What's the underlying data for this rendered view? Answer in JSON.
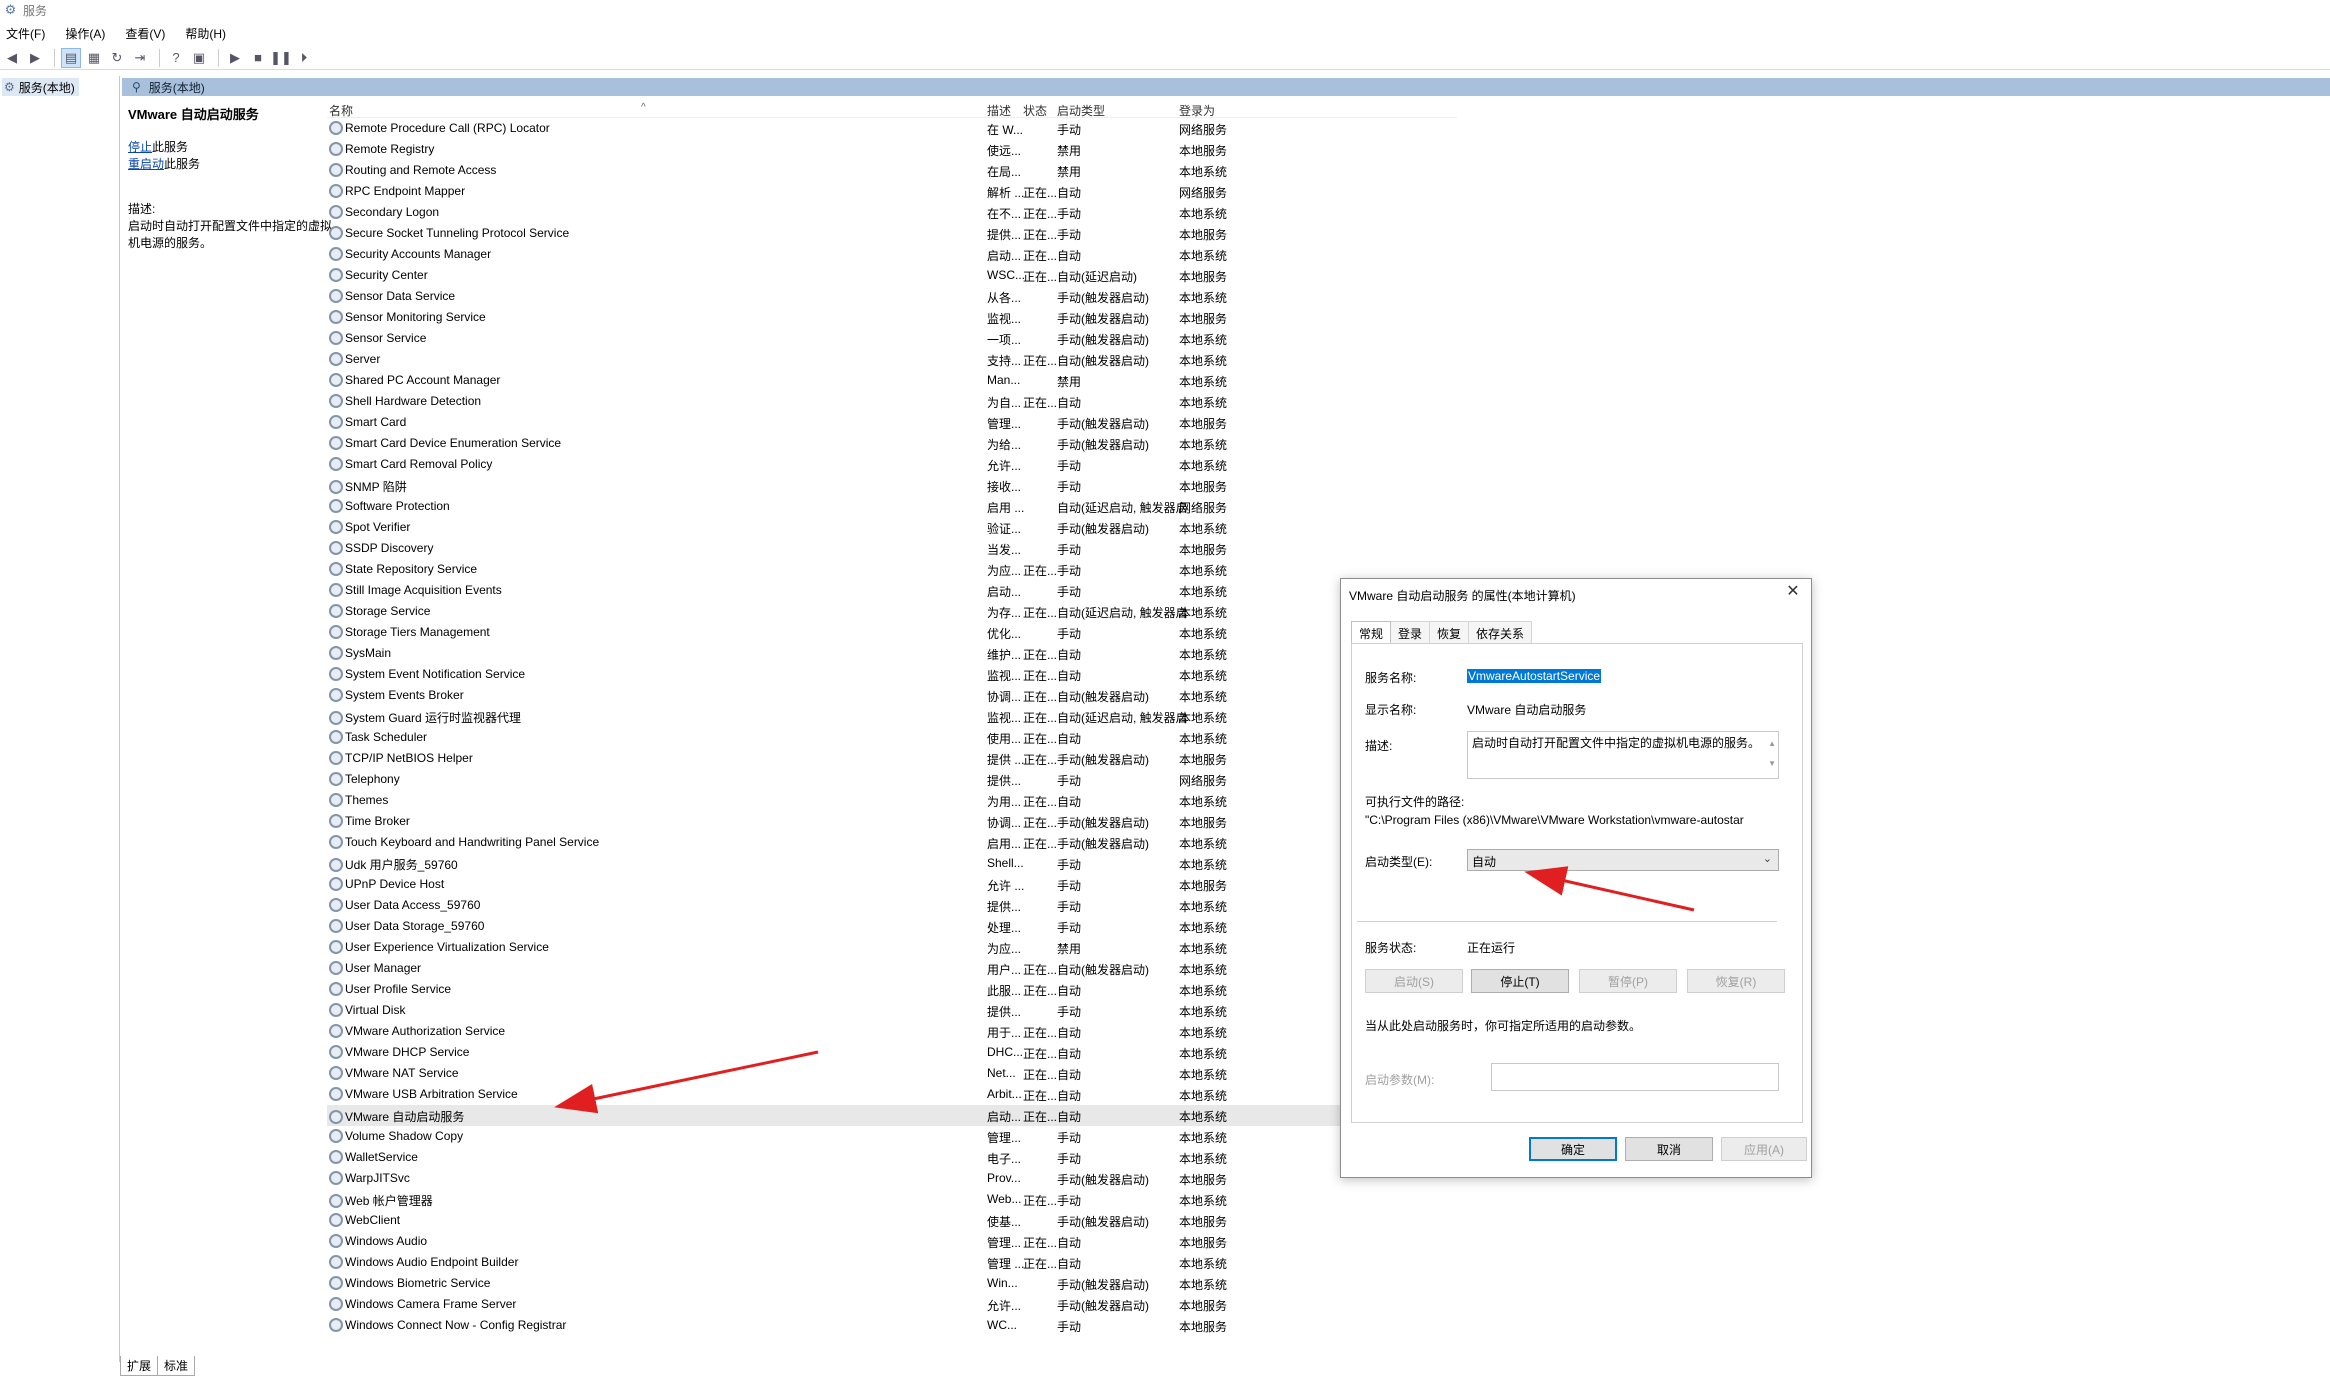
{
  "window": {
    "title": "服务"
  },
  "menu": [
    "文件(F)",
    "操作(A)",
    "查看(V)",
    "帮助(H)"
  ],
  "tree": {
    "root": "服务(本地)"
  },
  "pane": {
    "header": "服务(本地)"
  },
  "desc": {
    "service_name": "VMware 自动启动服务",
    "stop_link": "停止",
    "stop_suffix": "此服务",
    "restart_link": "重启动",
    "restart_suffix": "此服务",
    "label": "描述:",
    "text": "启动时自动打开配置文件中指定的虚拟机电源的服务。"
  },
  "columns": {
    "name": "名称",
    "desc": "描述",
    "status": "状态",
    "startup": "启动类型",
    "logon": "登录为"
  },
  "rows": [
    {
      "name": "Remote Procedure Call (RPC) Locator",
      "desc": "在 W...",
      "status": "",
      "startup": "手动",
      "logon": "网络服务"
    },
    {
      "name": "Remote Registry",
      "desc": "使远...",
      "status": "",
      "startup": "禁用",
      "logon": "本地服务"
    },
    {
      "name": "Routing and Remote Access",
      "desc": "在局...",
      "status": "",
      "startup": "禁用",
      "logon": "本地系统"
    },
    {
      "name": "RPC Endpoint Mapper",
      "desc": "解析 ...",
      "status": "正在...",
      "startup": "自动",
      "logon": "网络服务"
    },
    {
      "name": "Secondary Logon",
      "desc": "在不...",
      "status": "正在...",
      "startup": "手动",
      "logon": "本地系统"
    },
    {
      "name": "Secure Socket Tunneling Protocol Service",
      "desc": "提供...",
      "status": "正在...",
      "startup": "手动",
      "logon": "本地服务"
    },
    {
      "name": "Security Accounts Manager",
      "desc": "启动...",
      "status": "正在...",
      "startup": "自动",
      "logon": "本地系统"
    },
    {
      "name": "Security Center",
      "desc": "WSC...",
      "status": "正在...",
      "startup": "自动(延迟启动)",
      "logon": "本地服务"
    },
    {
      "name": "Sensor Data Service",
      "desc": "从各...",
      "status": "",
      "startup": "手动(触发器启动)",
      "logon": "本地系统"
    },
    {
      "name": "Sensor Monitoring Service",
      "desc": "监视...",
      "status": "",
      "startup": "手动(触发器启动)",
      "logon": "本地服务"
    },
    {
      "name": "Sensor Service",
      "desc": "一项...",
      "status": "",
      "startup": "手动(触发器启动)",
      "logon": "本地系统"
    },
    {
      "name": "Server",
      "desc": "支持...",
      "status": "正在...",
      "startup": "自动(触发器启动)",
      "logon": "本地系统"
    },
    {
      "name": "Shared PC Account Manager",
      "desc": "Man...",
      "status": "",
      "startup": "禁用",
      "logon": "本地系统"
    },
    {
      "name": "Shell Hardware Detection",
      "desc": "为自...",
      "status": "正在...",
      "startup": "自动",
      "logon": "本地系统"
    },
    {
      "name": "Smart Card",
      "desc": "管理...",
      "status": "",
      "startup": "手动(触发器启动)",
      "logon": "本地服务"
    },
    {
      "name": "Smart Card Device Enumeration Service",
      "desc": "为给...",
      "status": "",
      "startup": "手动(触发器启动)",
      "logon": "本地系统"
    },
    {
      "name": "Smart Card Removal Policy",
      "desc": "允许...",
      "status": "",
      "startup": "手动",
      "logon": "本地系统"
    },
    {
      "name": "SNMP 陷阱",
      "desc": "接收...",
      "status": "",
      "startup": "手动",
      "logon": "本地服务"
    },
    {
      "name": "Software Protection",
      "desc": "启用 ...",
      "status": "",
      "startup": "自动(延迟启动, 触发器启动)",
      "logon": "网络服务"
    },
    {
      "name": "Spot Verifier",
      "desc": "验证...",
      "status": "",
      "startup": "手动(触发器启动)",
      "logon": "本地系统"
    },
    {
      "name": "SSDP Discovery",
      "desc": "当发...",
      "status": "",
      "startup": "手动",
      "logon": "本地服务"
    },
    {
      "name": "State Repository Service",
      "desc": "为应...",
      "status": "正在...",
      "startup": "手动",
      "logon": "本地系统"
    },
    {
      "name": "Still Image Acquisition Events",
      "desc": "启动...",
      "status": "",
      "startup": "手动",
      "logon": "本地系统"
    },
    {
      "name": "Storage Service",
      "desc": "为存...",
      "status": "正在...",
      "startup": "自动(延迟启动, 触发器启动)",
      "logon": "本地系统"
    },
    {
      "name": "Storage Tiers Management",
      "desc": "优化...",
      "status": "",
      "startup": "手动",
      "logon": "本地系统"
    },
    {
      "name": "SysMain",
      "desc": "维护...",
      "status": "正在...",
      "startup": "自动",
      "logon": "本地系统"
    },
    {
      "name": "System Event Notification Service",
      "desc": "监视...",
      "status": "正在...",
      "startup": "自动",
      "logon": "本地系统"
    },
    {
      "name": "System Events Broker",
      "desc": "协调...",
      "status": "正在...",
      "startup": "自动(触发器启动)",
      "logon": "本地系统"
    },
    {
      "name": "System Guard 运行时监视器代理",
      "desc": "监视...",
      "status": "正在...",
      "startup": "自动(延迟启动, 触发器启动)",
      "logon": "本地系统"
    },
    {
      "name": "Task Scheduler",
      "desc": "使用...",
      "status": "正在...",
      "startup": "自动",
      "logon": "本地系统"
    },
    {
      "name": "TCP/IP NetBIOS Helper",
      "desc": "提供 ...",
      "status": "正在...",
      "startup": "手动(触发器启动)",
      "logon": "本地服务"
    },
    {
      "name": "Telephony",
      "desc": "提供...",
      "status": "",
      "startup": "手动",
      "logon": "网络服务"
    },
    {
      "name": "Themes",
      "desc": "为用...",
      "status": "正在...",
      "startup": "自动",
      "logon": "本地系统"
    },
    {
      "name": "Time Broker",
      "desc": "协调...",
      "status": "正在...",
      "startup": "手动(触发器启动)",
      "logon": "本地服务"
    },
    {
      "name": "Touch Keyboard and Handwriting Panel Service",
      "desc": "启用...",
      "status": "正在...",
      "startup": "手动(触发器启动)",
      "logon": "本地系统"
    },
    {
      "name": "Udk 用户服务_59760",
      "desc": "Shell...",
      "status": "",
      "startup": "手动",
      "logon": "本地系统"
    },
    {
      "name": "UPnP Device Host",
      "desc": "允许 ...",
      "status": "",
      "startup": "手动",
      "logon": "本地服务"
    },
    {
      "name": "User Data Access_59760",
      "desc": "提供...",
      "status": "",
      "startup": "手动",
      "logon": "本地系统"
    },
    {
      "name": "User Data Storage_59760",
      "desc": "处理...",
      "status": "",
      "startup": "手动",
      "logon": "本地系统"
    },
    {
      "name": "User Experience Virtualization Service",
      "desc": "为应...",
      "status": "",
      "startup": "禁用",
      "logon": "本地系统"
    },
    {
      "name": "User Manager",
      "desc": "用户...",
      "status": "正在...",
      "startup": "自动(触发器启动)",
      "logon": "本地系统"
    },
    {
      "name": "User Profile Service",
      "desc": "此服...",
      "status": "正在...",
      "startup": "自动",
      "logon": "本地系统"
    },
    {
      "name": "Virtual Disk",
      "desc": "提供...",
      "status": "",
      "startup": "手动",
      "logon": "本地系统"
    },
    {
      "name": "VMware Authorization Service",
      "desc": "用于...",
      "status": "正在...",
      "startup": "自动",
      "logon": "本地系统"
    },
    {
      "name": "VMware DHCP Service",
      "desc": "DHC...",
      "status": "正在...",
      "startup": "自动",
      "logon": "本地系统"
    },
    {
      "name": "VMware NAT Service",
      "desc": "Net...",
      "status": "正在...",
      "startup": "自动",
      "logon": "本地系统"
    },
    {
      "name": "VMware USB Arbitration Service",
      "desc": "Arbit...",
      "status": "正在...",
      "startup": "自动",
      "logon": "本地系统"
    },
    {
      "name": "VMware 自动启动服务",
      "desc": "启动...",
      "status": "正在...",
      "startup": "自动",
      "logon": "本地系统"
    },
    {
      "name": "Volume Shadow Copy",
      "desc": "管理...",
      "status": "",
      "startup": "手动",
      "logon": "本地系统"
    },
    {
      "name": "WalletService",
      "desc": "电子...",
      "status": "",
      "startup": "手动",
      "logon": "本地系统"
    },
    {
      "name": "WarpJITSvc",
      "desc": "Prov...",
      "status": "",
      "startup": "手动(触发器启动)",
      "logon": "本地服务"
    },
    {
      "name": "Web 帐户管理器",
      "desc": "Web...",
      "status": "正在...",
      "startup": "手动",
      "logon": "本地系统"
    },
    {
      "name": "WebClient",
      "desc": "使基...",
      "status": "",
      "startup": "手动(触发器启动)",
      "logon": "本地服务"
    },
    {
      "name": "Windows Audio",
      "desc": "管理...",
      "status": "正在...",
      "startup": "自动",
      "logon": "本地服务"
    },
    {
      "name": "Windows Audio Endpoint Builder",
      "desc": "管理 ...",
      "status": "正在...",
      "startup": "自动",
      "logon": "本地系统"
    },
    {
      "name": "Windows Biometric Service",
      "desc": "Win...",
      "status": "",
      "startup": "手动(触发器启动)",
      "logon": "本地系统"
    },
    {
      "name": "Windows Camera Frame Server",
      "desc": "允许...",
      "status": "",
      "startup": "手动(触发器启动)",
      "logon": "本地服务"
    },
    {
      "name": "Windows Connect Now - Config Registrar",
      "desc": "WC...",
      "status": "",
      "startup": "手动",
      "logon": "本地服务"
    }
  ],
  "bottom_tabs": [
    "扩展",
    "标准"
  ],
  "dialog": {
    "title": "VMware 自动启动服务 的属性(本地计算机)",
    "tabs": [
      "常规",
      "登录",
      "恢复",
      "依存关系"
    ],
    "service_name_label": "服务名称:",
    "service_name": "VmwareAutostartService",
    "display_name_label": "显示名称:",
    "display_name": "VMware 自动启动服务",
    "desc_label": "描述:",
    "desc": "启动时自动打开配置文件中指定的虚拟机电源的服务。",
    "path_label": "可执行文件的路径:",
    "path": "\"C:\\Program Files (x86)\\VMware\\VMware Workstation\\vmware-autostar",
    "startup_label": "启动类型(E):",
    "startup_value": "自动",
    "status_label": "服务状态:",
    "status_value": "正在运行",
    "btn_start": "启动(S)",
    "btn_stop": "停止(T)",
    "btn_pause": "暂停(P)",
    "btn_resume": "恢复(R)",
    "hint": "当从此处启动服务时，你可指定所适用的启动参数。",
    "param_label": "启动参数(M):",
    "btn_ok": "确定",
    "btn_cancel": "取消",
    "btn_apply": "应用(A)"
  },
  "colors": {
    "selection": "#0078d7",
    "pane_header": "#a8c0dc",
    "arrow": "#e02020"
  }
}
